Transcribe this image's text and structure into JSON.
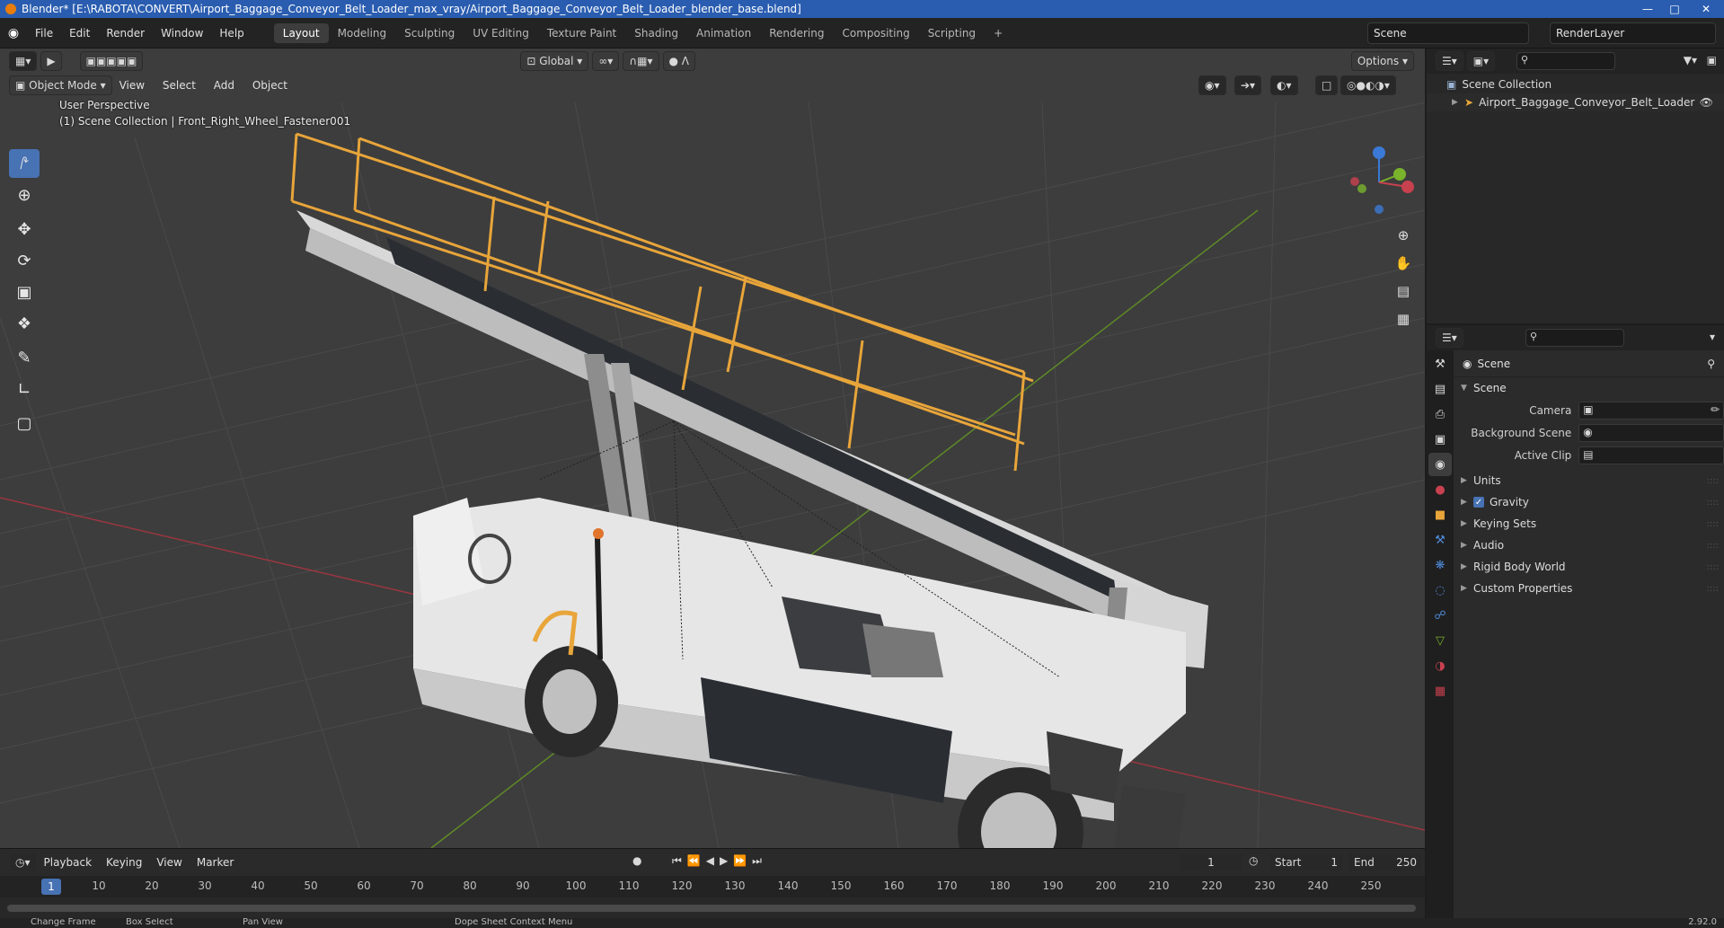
{
  "titlebar": {
    "title": "Blender* [E:\\RABOTA\\CONVERT\\Airport_Baggage_Conveyor_Belt_Loader_max_vray/Airport_Baggage_Conveyor_Belt_Loader_blender_base.blend]"
  },
  "menu": {
    "items": [
      "File",
      "Edit",
      "Render",
      "Window",
      "Help"
    ]
  },
  "workspaces": [
    "Layout",
    "Modeling",
    "Sculpting",
    "UV Editing",
    "Texture Paint",
    "Shading",
    "Animation",
    "Rendering",
    "Compositing",
    "Scripting"
  ],
  "active_workspace": "Layout",
  "scene_name": "Scene",
  "render_layer": "RenderLayer",
  "viewport": {
    "transform_orientation": "Global",
    "options_label": "Options",
    "mode": "Object Mode",
    "menu": [
      "View",
      "Select",
      "Add",
      "Object"
    ],
    "perspective": "User Perspective",
    "active_object": "(1) Scene Collection | Front_Right_Wheel_Fastener001"
  },
  "timeline": {
    "menu": [
      "Playback",
      "Keying",
      "View",
      "Marker"
    ],
    "current_frame": "1",
    "start_label": "Start",
    "start": "1",
    "end_label": "End",
    "end": "250",
    "frame_ticks": [
      "10",
      "20",
      "30",
      "40",
      "50",
      "60",
      "70",
      "80",
      "90",
      "100",
      "110",
      "120",
      "130",
      "140",
      "150",
      "160",
      "170",
      "180",
      "190",
      "200",
      "210",
      "220",
      "230",
      "240",
      "250"
    ],
    "current_marker": "1"
  },
  "status": {
    "change_frame": "Change Frame",
    "box_select": "Box Select",
    "pan_view": "Pan View",
    "context_menu": "Dope Sheet Context Menu",
    "version": "2.92.0"
  },
  "outliner": {
    "root": "Scene Collection",
    "items": [
      "Airport_Baggage_Conveyor_Belt_Loader"
    ]
  },
  "properties": {
    "context_title": "Scene",
    "section": "Scene",
    "fields": {
      "camera": "Camera",
      "background_scene": "Background Scene",
      "active_clip": "Active Clip"
    },
    "subsections": [
      "Units",
      "Gravity",
      "Keying Sets",
      "Audio",
      "Rigid Body World",
      "Custom Properties"
    ],
    "gravity_checked": true
  },
  "colors": {
    "accent": "#4772b3",
    "title_bar": "#2a5db0",
    "conveyor_rail": "#e8a53a",
    "axis_x": "#c8414f",
    "axis_y": "#7ab32c",
    "axis_z": "#3b79d6"
  }
}
